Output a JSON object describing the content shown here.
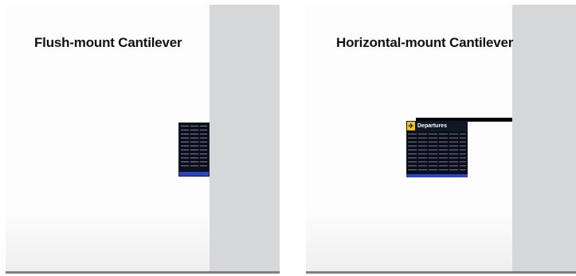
{
  "panels": {
    "left": {
      "title": "Flush-mount Cantilever"
    },
    "right": {
      "title": "Horizontal-mount Cantilever",
      "sign": {
        "badge_icon": "airplane-icon",
        "badge_glyph": "✈",
        "title": "Departures"
      }
    }
  },
  "colors": {
    "wall": "#d6d7d8",
    "sign_background": "#0c0f1c",
    "sign_accent": "#2a44c8",
    "badge": "#f2c31a",
    "arm": "#050505"
  }
}
